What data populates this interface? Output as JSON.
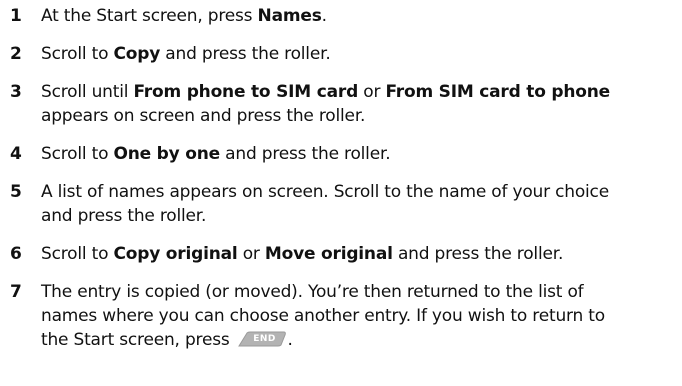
{
  "steps": [
    {
      "number": "1",
      "lines": [
        [
          "At the Start screen, press ",
          "Names",
          "."
        ]
      ]
    },
    {
      "number": "2",
      "lines": [
        [
          "Scroll to ",
          "Copy",
          " and press the roller."
        ]
      ]
    },
    {
      "number": "3",
      "line1": {
        "a": "Scroll until ",
        "b1": "From phone to SIM card",
        "c": " or ",
        "b2": "From SIM card to phone"
      },
      "line2": "appears on screen and press the roller."
    },
    {
      "number": "4",
      "a": "Scroll to ",
      "b": "One by one",
      "c": " and press the roller."
    },
    {
      "number": "5",
      "line1": "A list of names appears on screen. Scroll to the name of your choice",
      "line2": "and press the roller."
    },
    {
      "number": "6",
      "a": "Scroll to ",
      "b1": "Copy original",
      "c": " or ",
      "b2": "Move original",
      "d": " and press the roller."
    },
    {
      "number": "7",
      "line1": "The entry is copied (or moved). You’re then returned to the list of",
      "line2": "names where you can choose another entry. If you wish to return to",
      "line3": "the Start screen, press",
      "line3_end": "."
    }
  ],
  "end_key": {
    "label": "END",
    "icon": "end-key-icon",
    "color": "#b3b3b3"
  }
}
